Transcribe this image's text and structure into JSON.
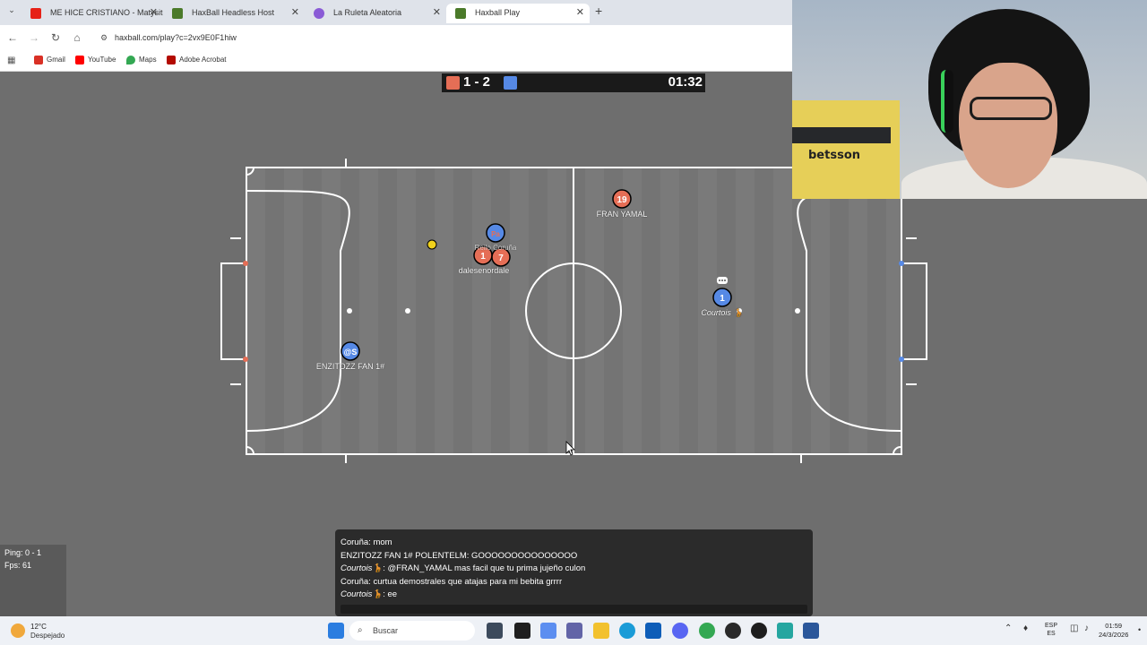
{
  "browser": {
    "tabs": [
      {
        "title": "ME HICE CRISTIANO - Matysito",
        "favicon_color": "#e62117"
      },
      {
        "title": "HaxBall Headless Host",
        "favicon_color": "#4b7a2a"
      },
      {
        "title": "La Ruleta Aleatoria",
        "favicon_color": "#8a5bd6"
      },
      {
        "title": "Haxball Play",
        "favicon_color": "#4b7a2a"
      }
    ],
    "url": "haxball.com/play?c=2vx9E0F1hiw",
    "bookmarks": [
      {
        "label": "Gmail",
        "color": "#d93025"
      },
      {
        "label": "YouTube",
        "color": "#ff0000"
      },
      {
        "label": "Maps",
        "color": "#34a853"
      },
      {
        "label": "Adobe Acrobat",
        "color": "#b30b00"
      }
    ]
  },
  "scoreboard": {
    "score": "1 - 2",
    "time": "01:32",
    "red_color": "#e56e56",
    "blue_color": "#5689e5"
  },
  "players": {
    "red": [
      {
        "number": "19",
        "name": "FRAN YAMAL"
      },
      {
        "number": "1",
        "name": "dalesenordale"
      },
      {
        "number": "7",
        "name": "Reilo Coruña"
      }
    ],
    "blue": [
      {
        "number": "@S",
        "name": "ENZITOZZ FAN 1#"
      },
      {
        "number": "Pa",
        "name": ""
      },
      {
        "number": "1",
        "name": "Courtois 🦒"
      }
    ]
  },
  "stats": {
    "ping": "Ping: 0 - 1",
    "fps": "Fps: 61"
  },
  "chat": [
    {
      "author": "Coruña",
      "text": ": mom",
      "italic": false
    },
    {
      "author": "ENZITOZZ FAN 1# POLENTELM",
      "text": ": GOOOOOOOOOOOOOOO",
      "italic": false
    },
    {
      "author": "Courtois🦒",
      "text": ": @FRAN_YAMAL mas facil que tu prima jujeño culon",
      "italic": true
    },
    {
      "author": "Coruña",
      "text": ": curtua demostrales que atajas para mi bebita grrrr",
      "italic": false
    },
    {
      "author": "Courtois🦒",
      "text": ": ee",
      "italic": true
    }
  ],
  "webcam": {
    "sign": "betsson"
  },
  "taskbar": {
    "temperature": "12°C",
    "condition": "Despejado",
    "search_placeholder": "Buscar",
    "lang_top": "ESP",
    "lang_bottom": "ES",
    "time": "01:59",
    "date": "24/3/2026"
  }
}
